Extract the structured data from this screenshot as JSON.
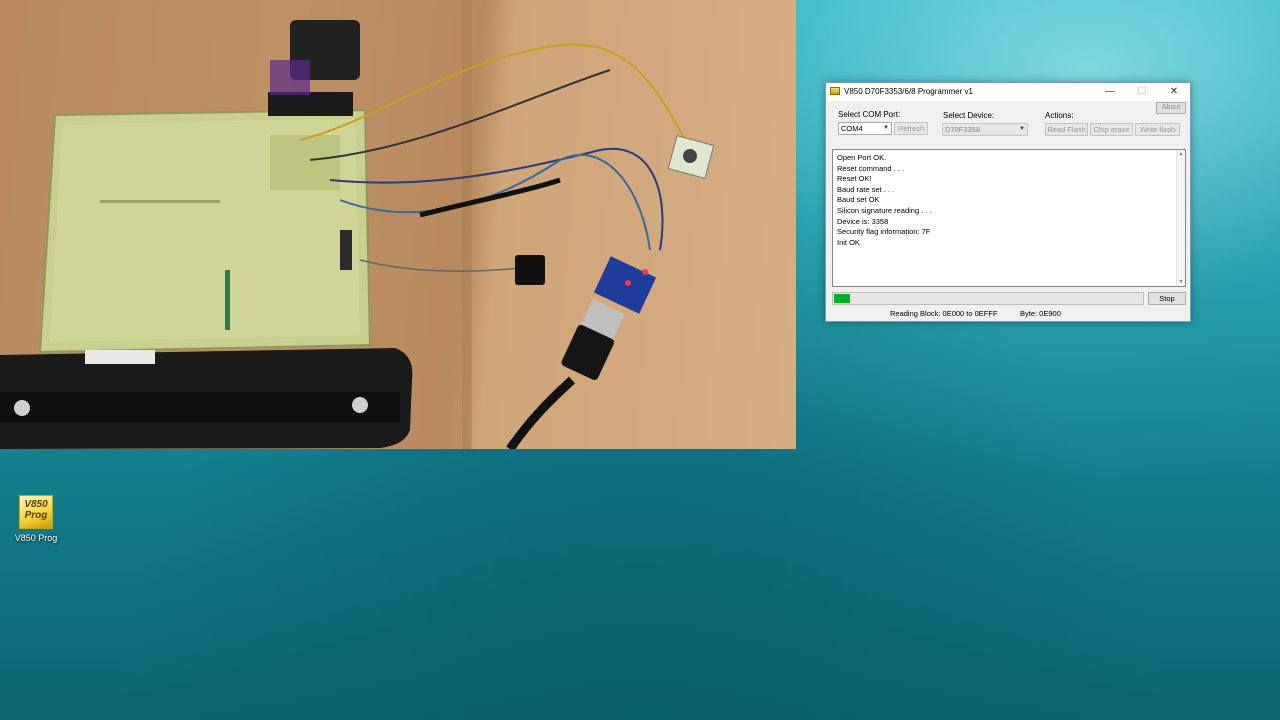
{
  "window": {
    "title": "V850 D70F3353/6/8 Programmer v1",
    "minimize_glyph": "—",
    "maximize_glyph": "☐",
    "close_glyph": "✕",
    "about_label": "About"
  },
  "com_port": {
    "label": "Select COM Port:",
    "value": "COM4",
    "refresh_label": "Refresh"
  },
  "device": {
    "label": "Select Device:",
    "value": "D70F3358"
  },
  "actions": {
    "label": "Actions:",
    "read_flash": "Read Flash",
    "chip_erase": "Chip erase",
    "write_flash": "Write flash"
  },
  "log": {
    "lines": [
      "Open Port OK.",
      "Reset command . . .",
      "Reset OK!",
      "Baud rate set . . .",
      "Baud set OK",
      "Silicon signature reading . . .",
      "Device is: 3358",
      "Security flag information: 7F",
      "Init OK"
    ]
  },
  "progress": {
    "fraction": 0.05,
    "color": "#06b025"
  },
  "stop_label": "Stop",
  "status": {
    "reading_block": "Reading Block: 0E000 to 0EFFF",
    "byte": "Byte: 0E900"
  },
  "desktop_icon": {
    "icon_text_1": "V850",
    "icon_text_2": "Prog",
    "label": "V850 Prog"
  }
}
